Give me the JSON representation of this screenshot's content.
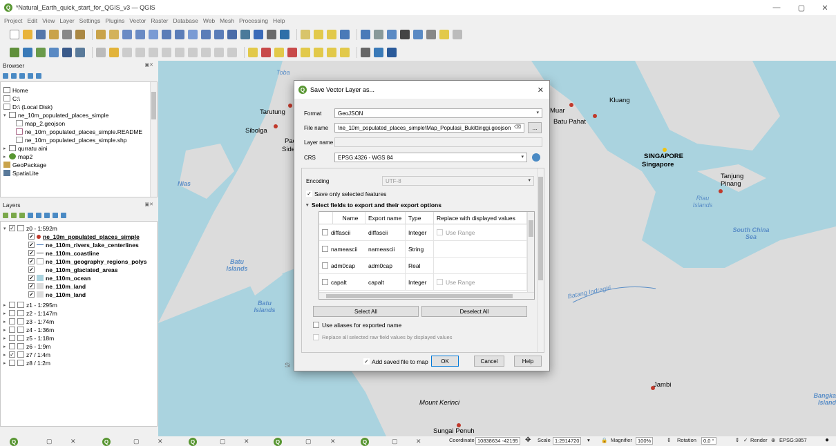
{
  "window": {
    "title": "*Natural_Earth_quick_start_for_QGIS_v3 — QGIS",
    "minimize": "—",
    "maximize": "▢",
    "close": "✕"
  },
  "menu": [
    "Project",
    "Edit",
    "View",
    "Layer",
    "Settings",
    "Plugins",
    "Vector",
    "Raster",
    "Database",
    "Web",
    "Mesh",
    "Processing",
    "Help"
  ],
  "browser": {
    "title": "Browser",
    "items": [
      "Home",
      "C:\\",
      "D:\\ (Local Disk)",
      "ne_10m_populated_places_simple",
      "map_2.geojson",
      "ne_10m_populated_places_simple.README",
      "ne_10m_populated_places_simple.shp",
      "qurratu aini",
      "map2",
      "GeoPackage",
      "SpatiaLite"
    ]
  },
  "layers": {
    "title": "Layers",
    "items": [
      "z0 - 1:592m",
      "ne_10m_populated_places_simple",
      "ne_110m_rivers_lake_centerlines",
      "ne_110m_coastline",
      "ne_110m_geography_regions_polys",
      "ne_110m_glaciated_areas",
      "ne_110m_ocean",
      "ne_110m_land",
      "ne_110m_land",
      "z1 - 1:295m",
      "z2 - 1:147m",
      "z3 - 1:74m",
      "z4 - 1:36m",
      "z5 - 1:18m",
      "z6 - 1:9m",
      "z7 / 1:4m",
      "z8 / 1:2m"
    ]
  },
  "map": {
    "labels": [
      "Toba",
      "Tarutung",
      "Sibolga",
      "Pad",
      "Sidemp",
      "Nias",
      "Batu Islands",
      "Batu Islands",
      "Muar",
      "Kluang",
      "Batu Pahat",
      "SINGAPORE",
      "Singapore",
      "Tanjung Pinang",
      "Riau Islands",
      "South China Sea",
      "Batang Indragiri",
      "Jambi",
      "Mount Kerinci",
      "Sungai Penuh",
      "Bangka Island",
      "Si"
    ]
  },
  "dialog": {
    "title": "Save Vector Layer as...",
    "format_label": "Format",
    "format_value": "GeoJSON",
    "filename_label": "File name",
    "filename_value": "\\ne_10m_populated_places_simple\\Map_Populasi_Bukittinggi.geojson",
    "browse_label": "...",
    "layername_label": "Layer name",
    "layername_value": "",
    "crs_label": "CRS",
    "crs_value": "EPSG:4326 - WGS 84",
    "encoding_label": "Encoding",
    "encoding_value": "UTF-8",
    "save_selected_label": "Save only selected features",
    "fields_section": "Select fields to export and their export options",
    "columns": [
      "Name",
      "Export name",
      "Type",
      "Replace with displayed values"
    ],
    "rows": [
      {
        "name": "diffascii",
        "export": "diffascii",
        "type": "Integer",
        "replace": "Use Range"
      },
      {
        "name": "nameascii",
        "export": "nameascii",
        "type": "String",
        "replace": ""
      },
      {
        "name": "adm0cap",
        "export": "adm0cap",
        "type": "Real",
        "replace": ""
      },
      {
        "name": "capalt",
        "export": "capalt",
        "type": "Integer",
        "replace": "Use Range"
      }
    ],
    "select_all": "Select All",
    "deselect_all": "Deselect All",
    "use_aliases": "Use aliases for exported name",
    "replace_all": "Replace all selected raw field values by displayed values",
    "add_to_map": "Add saved file to map",
    "ok": "OK",
    "cancel": "Cancel",
    "help": "Help"
  },
  "status": {
    "coordinate_label": "Coordinate",
    "coordinate_value": "10838634 -42195",
    "scale_label": "Scale",
    "scale_value": "1:2914720",
    "magnifier_label": "Magnifier",
    "magnifier_value": "100%",
    "rotation_label": "Rotation",
    "rotation_value": "0,0 °",
    "render_label": "Render",
    "crs": "EPSG:3857"
  },
  "colors": {
    "water": "#aad3df",
    "land": "#dcdcdc",
    "accent": "#589632",
    "place_dot": "#c0392b",
    "sea_label": "#5a8ec7"
  }
}
